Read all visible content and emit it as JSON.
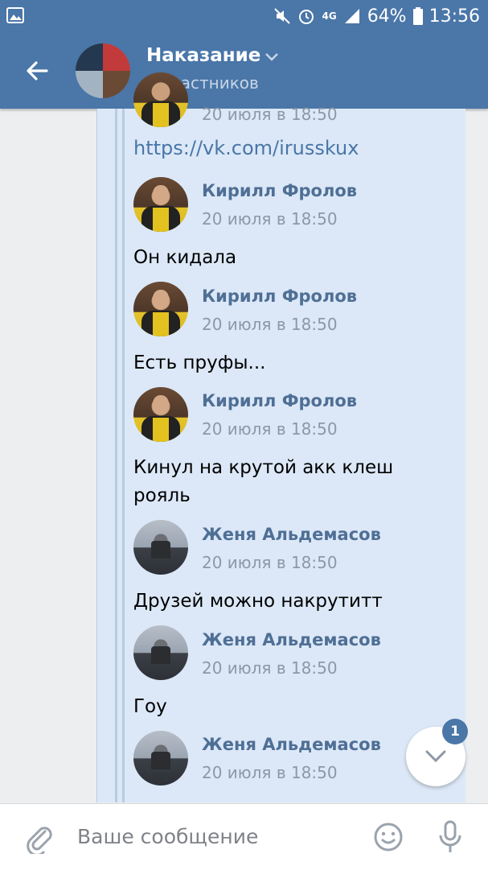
{
  "status_bar": {
    "network": "4G",
    "battery": "64%",
    "time": "13:56"
  },
  "header": {
    "title": "Наказание",
    "subtitle": "5 участников"
  },
  "messages": [
    {
      "date": "20 июля в 18:50"
    },
    {
      "author": "Кирилл Фролов",
      "date": "20 июля в 18:50",
      "text": "Он кидала"
    },
    {
      "author": "Кирилл Фролов",
      "date": "20 июля в 18:50",
      "text": "Есть пруфы..."
    },
    {
      "author": "Кирилл Фролов",
      "date": "20 июля в 18:50",
      "text": "Кинул на крутой акк клеш рояль"
    },
    {
      "author": "Женя Альдемасов",
      "date": "20 июля в 18:50",
      "text": "Друзей можно накрутитт"
    },
    {
      "author": "Женя Альдемасов",
      "date": "20 июля в 18:50",
      "text": "Гоу"
    },
    {
      "author": "Женя Альдемасов",
      "date": "20 июля в 18:50"
    }
  ],
  "link": "https://vk.com/irusskux",
  "scroll_badge": "1",
  "composer": {
    "placeholder": "Ваше сообщение"
  },
  "colors": {
    "accent": "#4a76a8",
    "forward_bg": "#dce8f7",
    "author": "#4f6f95"
  }
}
